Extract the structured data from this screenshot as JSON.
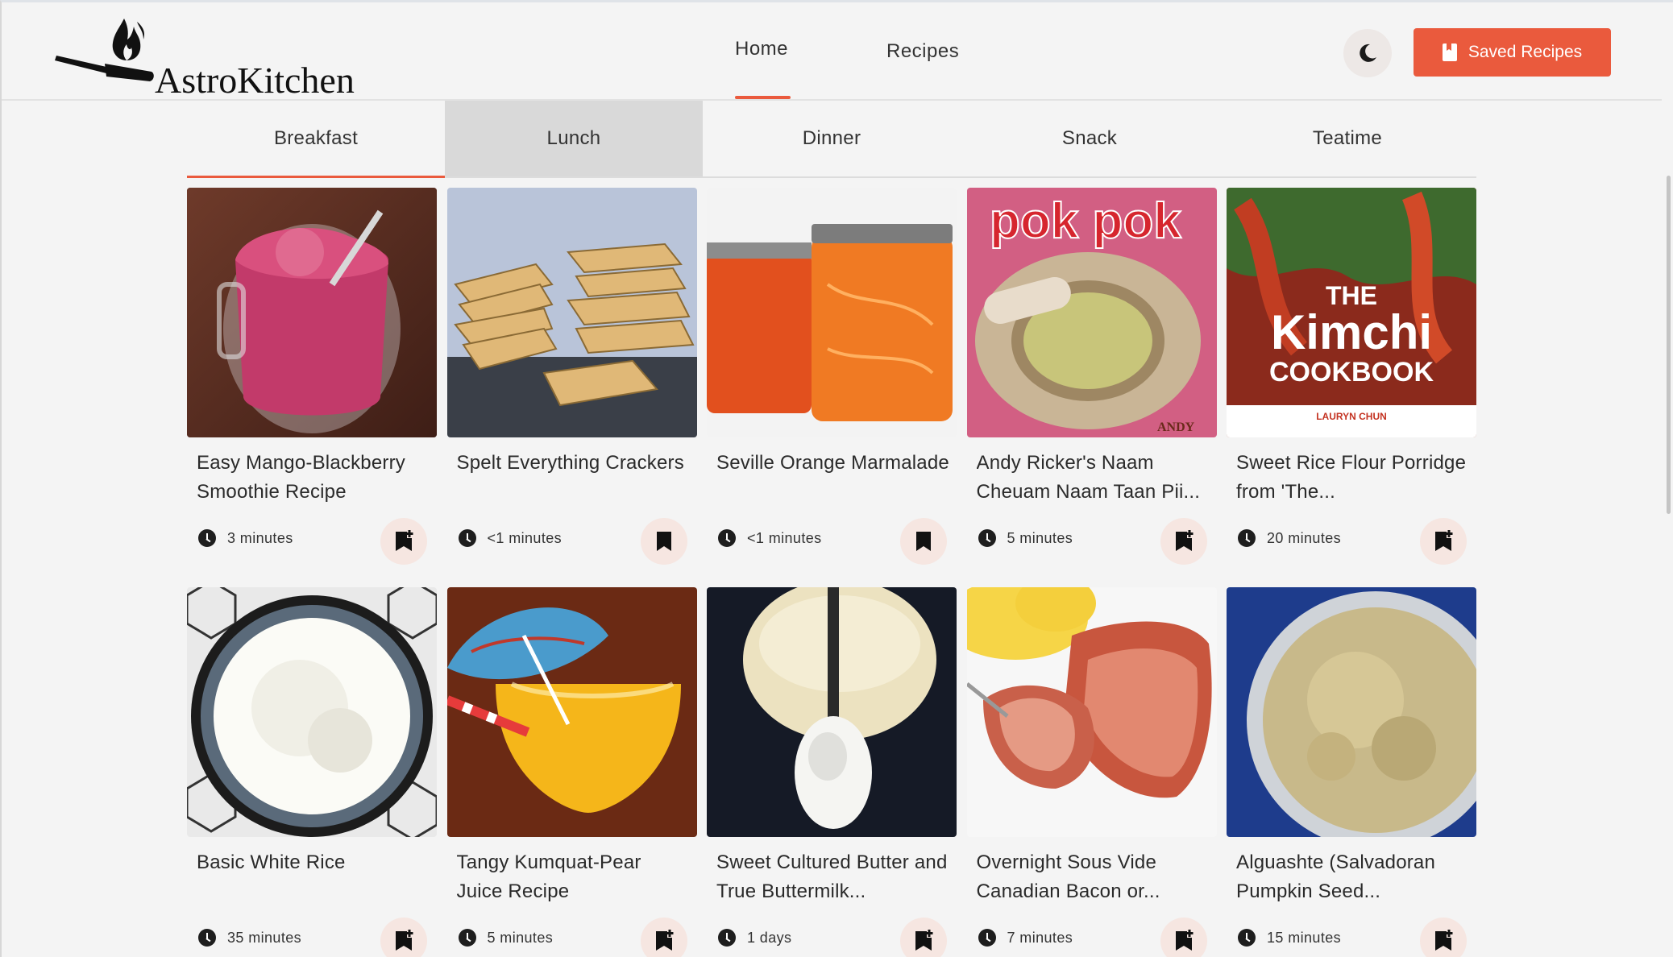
{
  "app": {
    "name": "AstroKitchen",
    "accent": "#ea5a3d"
  },
  "nav": {
    "home": "Home",
    "recipes": "Recipes",
    "active": "Home"
  },
  "header": {
    "theme_toggle_icon": "moon-icon",
    "saved_button_label": "Saved Recipes",
    "saved_button_icon": "bookmark-icon"
  },
  "tabs": [
    {
      "label": "Breakfast",
      "active": true
    },
    {
      "label": "Lunch",
      "hovered": true
    },
    {
      "label": "Dinner"
    },
    {
      "label": "Snack"
    },
    {
      "label": "Teatime"
    }
  ],
  "recipes": [
    {
      "title": "Easy Mango-Blackberry Smoothie Recipe",
      "time": "3 minutes",
      "saved": false,
      "image": "berry smoothie in glass"
    },
    {
      "title": "Spelt Everything Crackers",
      "time": "<1 minutes",
      "saved": true,
      "image": "stacked seeded crackers"
    },
    {
      "title": "Seville Orange Marmalade",
      "time": "<1 minutes",
      "saved": true,
      "image": "jars of orange marmalade"
    },
    {
      "title": "Andy Ricker's Naam Cheuam Naam Taan Pii...",
      "time": "5 minutes",
      "saved": false,
      "image": "pok pok cookbook cover",
      "image_text": "pok pok",
      "image_subtext": "ANDY"
    },
    {
      "title": "Sweet Rice Flour Porridge from 'The...",
      "time": "20 minutes",
      "saved": false,
      "image": "kimchi cookbook cover",
      "image_text_1": "THE",
      "image_text_2": "Kimchi",
      "image_text_3": "COOKBOOK",
      "image_text_4": "LAURYN CHUN"
    },
    {
      "title": "Basic White Rice",
      "time": "35 minutes",
      "saved": false,
      "image": "bowl of white rice"
    },
    {
      "title": "Tangy Kumquat-Pear Juice Recipe",
      "time": "5 minutes",
      "saved": false,
      "image": "juice with cocktail umbrella"
    },
    {
      "title": "Sweet Cultured Butter and True Buttermilk...",
      "time": "1 days",
      "saved": false,
      "image": "butter on spoon over jar"
    },
    {
      "title": "Overnight Sous Vide Canadian Bacon or...",
      "time": "7 minutes",
      "saved": false,
      "image": "canadian bacon with eggs"
    },
    {
      "title": "Alguashte (Salvadoran Pumpkin Seed...",
      "time": "15 minutes",
      "saved": false,
      "image": "ground pumpkin seed in bowl"
    }
  ]
}
